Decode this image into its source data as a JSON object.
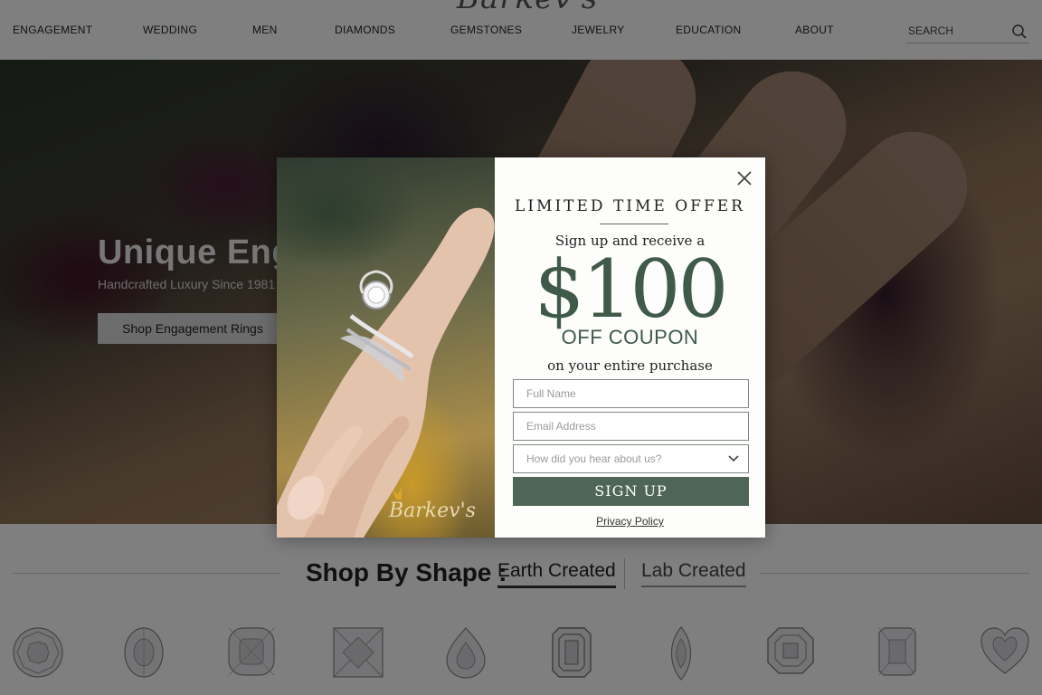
{
  "header": {
    "logo_text": "Barkev's",
    "nav": [
      {
        "label": "ENGAGEMENT"
      },
      {
        "label": "WEDDING"
      },
      {
        "label": "MEN"
      },
      {
        "label": "DIAMONDS"
      },
      {
        "label": "GEMSTONES"
      },
      {
        "label": "JEWELRY"
      },
      {
        "label": "EDUCATION"
      },
      {
        "label": "ABOUT"
      }
    ],
    "search": {
      "placeholder": "SEARCH",
      "icon": "search-icon"
    }
  },
  "hero": {
    "title": "Unique Enga",
    "subtitle": "Handcrafted Luxury Since 1981",
    "button_label": "Shop Engagement Rings"
  },
  "shapes": {
    "title": "Shop By Shape :",
    "tabs": [
      {
        "label": "Earth Created",
        "active": true
      },
      {
        "label": "Lab Created",
        "active": false
      }
    ],
    "gems": [
      {
        "shape": "round"
      },
      {
        "shape": "oval"
      },
      {
        "shape": "cushion"
      },
      {
        "shape": "princess"
      },
      {
        "shape": "pear"
      },
      {
        "shape": "emerald"
      },
      {
        "shape": "marquise"
      },
      {
        "shape": "asscher"
      },
      {
        "shape": "radiant"
      },
      {
        "shape": "heart"
      }
    ]
  },
  "modal": {
    "image_logo": "Barkev's",
    "headline": "LIMITED TIME OFFER",
    "subhead": "Sign up and receive a",
    "amount": "$100",
    "coupon": "OFF COUPON",
    "tail": "on your entire purchase",
    "fields": {
      "name_placeholder": "Full Name",
      "email_placeholder": "Email Address",
      "source_placeholder": "How did you hear about us?"
    },
    "button_label": "SIGN UP",
    "privacy_label": "Privacy Policy",
    "colors": {
      "accent": "#3f5a49",
      "button": "#4f6656"
    }
  }
}
